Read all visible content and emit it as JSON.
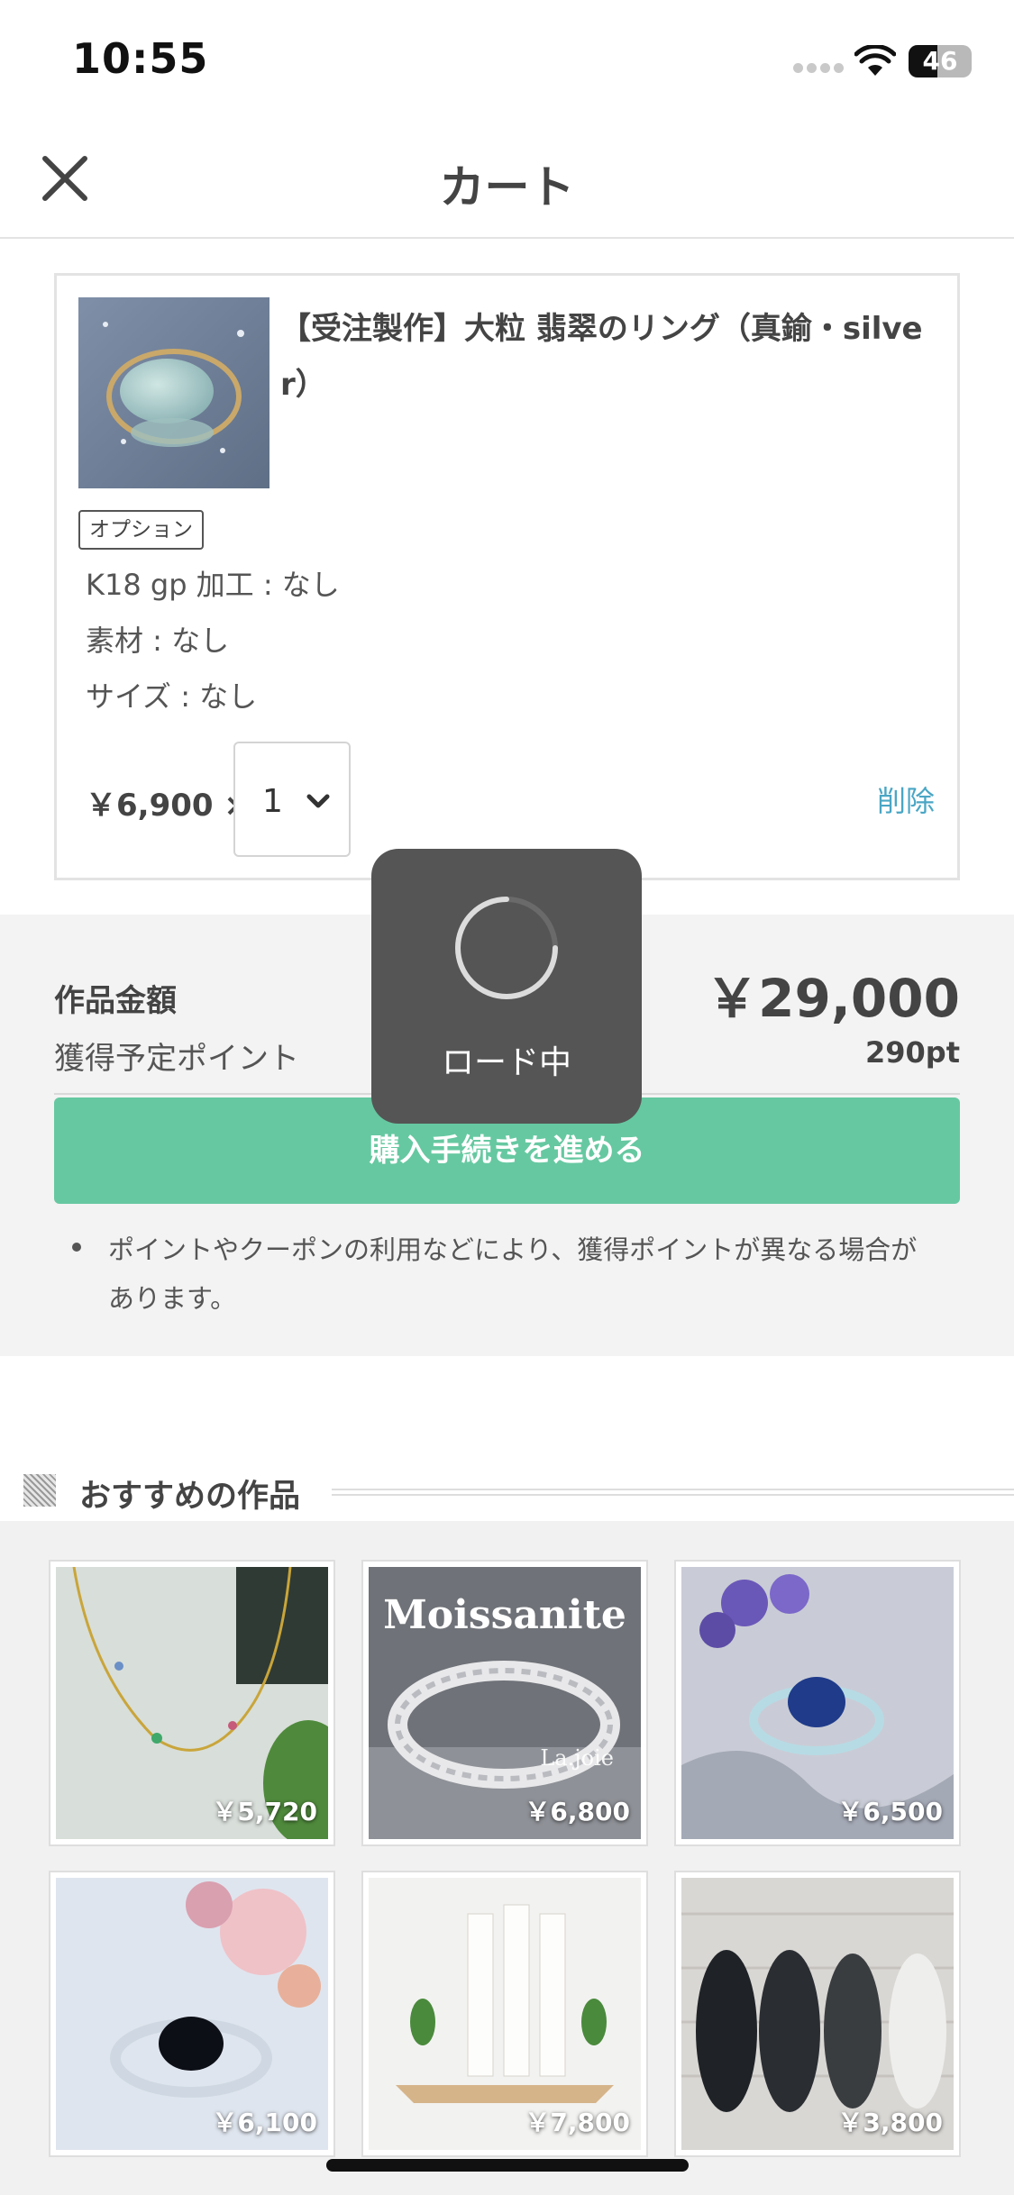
{
  "status_bar": {
    "time": "10:55",
    "battery": "46",
    "battery_level_percent": 46
  },
  "header": {
    "title": "カート",
    "close_icon": "close-icon"
  },
  "cart_item": {
    "title": "【受注製作】大粒 翡翠のリング（真鍮・silver）",
    "option_label": "オプション",
    "options": [
      "K18 gp 加工 : なし",
      "素材 : なし",
      "サイズ : なし"
    ],
    "price_text": "￥6,900 ×",
    "quantity": "1",
    "delete_label": "削除"
  },
  "summary": {
    "subtotal_label": "作品金額",
    "subtotal_value": "￥29,000",
    "points_label": "獲得予定ポイント",
    "points_value": "290pt",
    "checkout_label": "購入手続きを進める",
    "note": "ポイントやクーポンの利用などにより、獲得ポイントが異なる場合があります。"
  },
  "loading": {
    "text": "ロード中"
  },
  "recommendations": {
    "title": "おすすめの作品",
    "items": [
      {
        "price": "￥5,720",
        "overlay": ""
      },
      {
        "price": "￥6,800",
        "overlay": "Moissanite",
        "watermark": "La.joie"
      },
      {
        "price": "￥6,500",
        "overlay": ""
      },
      {
        "price": "￥6,100",
        "overlay": ""
      },
      {
        "price": "￥7,800",
        "overlay": ""
      },
      {
        "price": "￥3,800",
        "overlay": ""
      }
    ]
  },
  "colors": {
    "accent_green": "#66c8a1",
    "link_blue": "#4aa6c5",
    "overlay_gray": "#555555"
  }
}
